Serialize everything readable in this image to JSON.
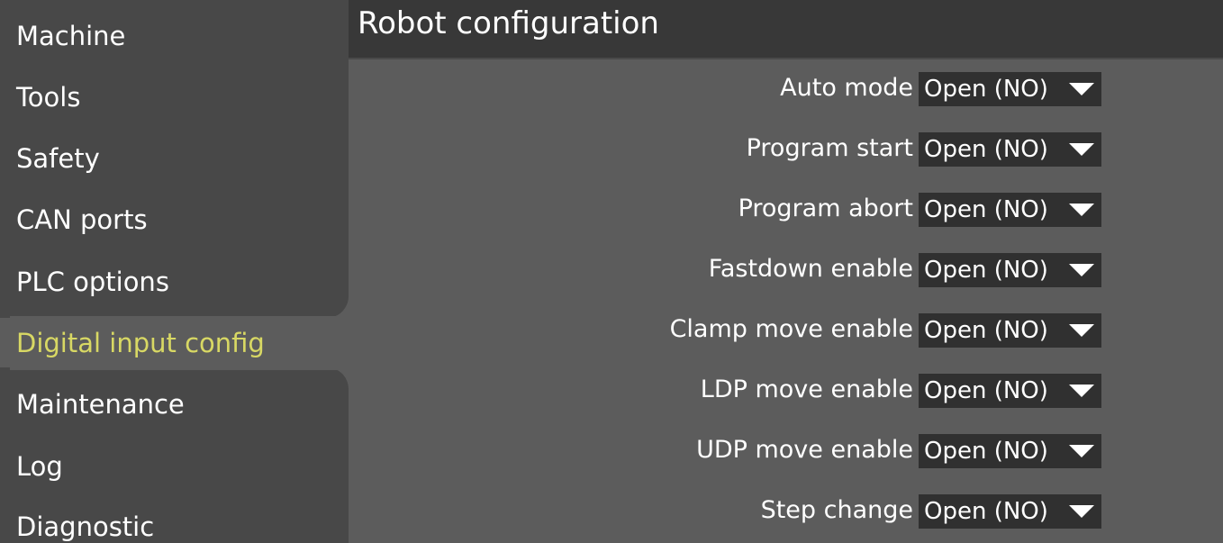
{
  "sidebar": {
    "items": [
      {
        "label": "Machine"
      },
      {
        "label": "Tools"
      },
      {
        "label": "Safety"
      },
      {
        "label": "CAN ports"
      },
      {
        "label": "PLC options"
      },
      {
        "label": "Digital input config",
        "active": true
      },
      {
        "label": "Maintenance"
      },
      {
        "label": "Log"
      },
      {
        "label": "Diagnostic"
      }
    ]
  },
  "panel": {
    "title": "Robot configuration",
    "rows": [
      {
        "label": "Auto mode",
        "value": "Open (NO)"
      },
      {
        "label": "Program start",
        "value": "Open (NO)"
      },
      {
        "label": "Program abort",
        "value": "Open (NO)"
      },
      {
        "label": "Fastdown enable",
        "value": "Open (NO)"
      },
      {
        "label": "Clamp move enable",
        "value": "Open (NO)"
      },
      {
        "label": "LDP move enable",
        "value": "Open (NO)"
      },
      {
        "label": "UDP move enable",
        "value": "Open (NO)"
      },
      {
        "label": "Step change",
        "value": "Open (NO)"
      }
    ]
  },
  "colors": {
    "active_nav_text": "#d8d864",
    "sidebar_bg": "#484848",
    "header_bg": "#383838",
    "select_bg": "#303030",
    "panel_bg": "#5c5c5c"
  },
  "icons": {
    "dropdown": "caret-down-icon"
  }
}
